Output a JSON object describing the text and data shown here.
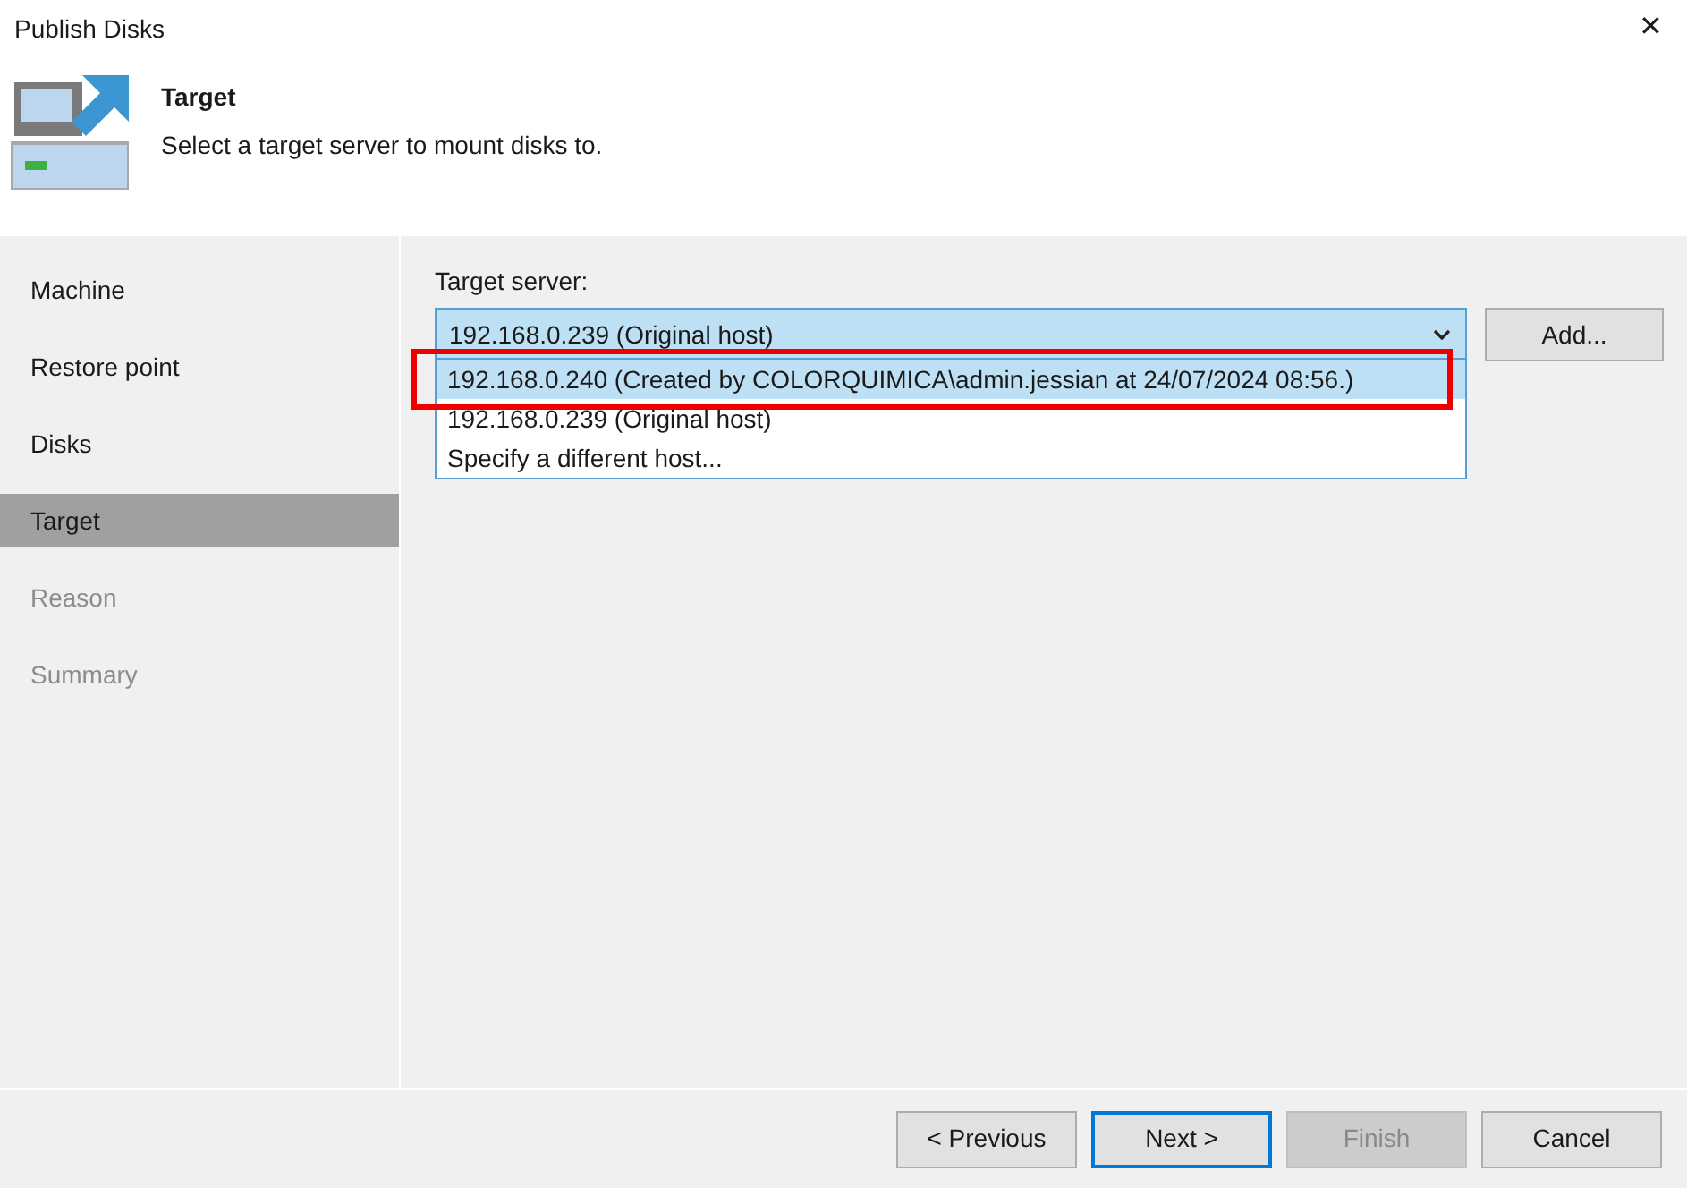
{
  "window": {
    "title": "Publish Disks",
    "close": "✕"
  },
  "header": {
    "title": "Target",
    "subtitle": "Select a target server to mount disks to."
  },
  "steps": [
    {
      "label": "Machine",
      "selected": false,
      "disabled": false
    },
    {
      "label": "Restore point",
      "selected": false,
      "disabled": false
    },
    {
      "label": "Disks",
      "selected": false,
      "disabled": false
    },
    {
      "label": "Target",
      "selected": true,
      "disabled": false
    },
    {
      "label": "Reason",
      "selected": false,
      "disabled": true
    },
    {
      "label": "Summary",
      "selected": false,
      "disabled": true
    }
  ],
  "target_server": {
    "label": "Target server:",
    "value": "192.168.0.239 (Original host)",
    "expanded": true,
    "options": [
      {
        "label": "192.168.0.240 (Created by COLORQUIMICA\\admin.jessian at 24/07/2024 08:56.)",
        "highlighted": true,
        "annotated": true
      },
      {
        "label": "192.168.0.239 (Original host)",
        "highlighted": false,
        "annotated": false
      },
      {
        "label": "Specify a different host...",
        "highlighted": false,
        "annotated": false
      }
    ],
    "add_button": "Add..."
  },
  "buttons": [
    {
      "label": "< Previous",
      "kind": "default"
    },
    {
      "label": "Next >",
      "kind": "focused"
    },
    {
      "label": "Finish",
      "kind": "disabled"
    },
    {
      "label": "Cancel",
      "kind": "default"
    }
  ]
}
